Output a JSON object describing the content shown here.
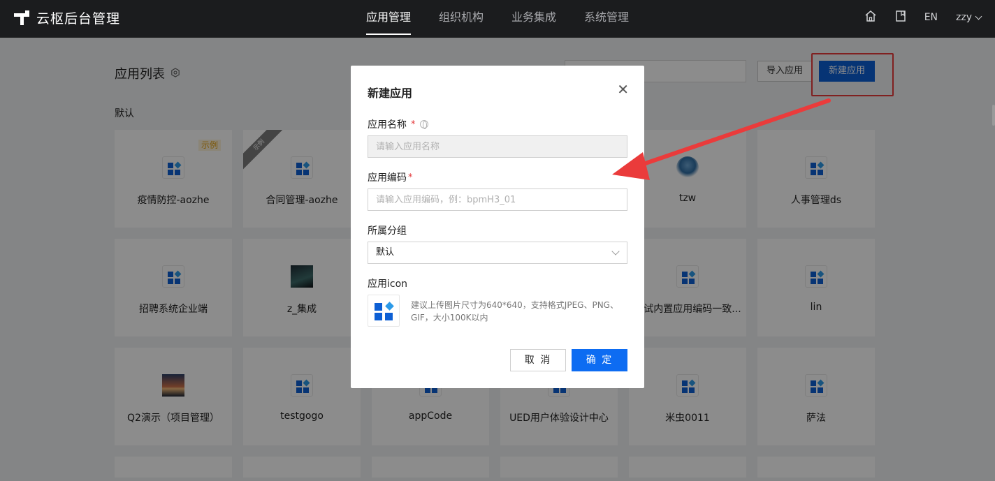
{
  "header": {
    "app_title": "云枢后台管理",
    "nav": [
      "应用管理",
      "组织机构",
      "业务集成",
      "系统管理"
    ],
    "lang": "EN",
    "user": "zzy"
  },
  "page": {
    "title": "应用列表",
    "import_label": "导入应用",
    "new_label": "新建应用",
    "group_label": "默认"
  },
  "cards": [
    {
      "name": "疫情防控-aozhe",
      "badge": "示例"
    },
    {
      "name": "合同管理-aozhe",
      "ribbon": "示例"
    },
    {
      "name": ""
    },
    {
      "name": ""
    },
    {
      "name": "tzw"
    },
    {
      "name": "人事管理ds"
    },
    {
      "name": "招聘系统企业端"
    },
    {
      "name": "z_集成"
    },
    {
      "name": ""
    },
    {
      "name": ""
    },
    {
      "name": "测试内置应用编码一致..."
    },
    {
      "name": "lin"
    },
    {
      "name": "Q2演示（项目管理）"
    },
    {
      "name": "testgogo"
    },
    {
      "name": "appCode"
    },
    {
      "name": "UED用户体验设计中心"
    },
    {
      "name": "米虫0011"
    },
    {
      "name": "萨法"
    }
  ],
  "dialog": {
    "title": "新建应用",
    "name_label": "应用名称",
    "name_placeholder": "请输入应用名称",
    "code_label": "应用编码",
    "code_placeholder": "请输入应用编码，例：bpmH3_01",
    "group_label": "所属分组",
    "group_value": "默认",
    "icon_label": "应用icon",
    "icon_hint": "建议上传图片尺寸为640*640，支持格式JPEG、PNG、GIF，大小100K以内",
    "cancel_label": "取 消",
    "ok_label": "确 定",
    "required_mark": "*"
  },
  "colors": {
    "primary": "#0d6cf2",
    "header_bg": "#1b1c1e",
    "annotation": "#ea3b3b"
  }
}
